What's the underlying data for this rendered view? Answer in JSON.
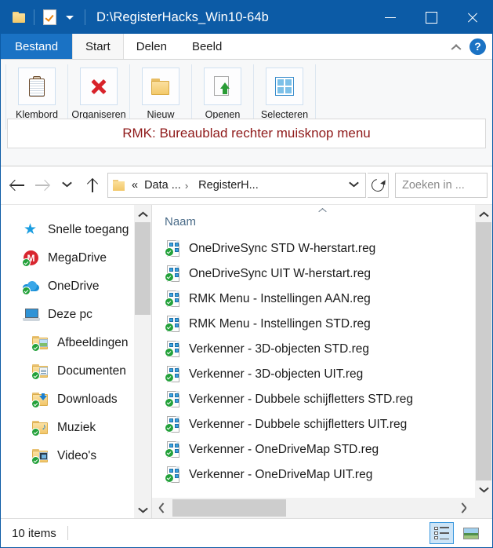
{
  "window": {
    "title": "D:\\RegisterHacks_Win10-64b",
    "quick_access": {
      "folder_icon": "folder-icon",
      "properties_icon": "properties-checkmark-icon",
      "customize_icon": "chevron-down-icon"
    },
    "controls": {
      "minimize": "minimize-icon",
      "maximize": "maximize-icon",
      "close": "close-icon"
    }
  },
  "tabs": [
    {
      "label": "Bestand",
      "state": "file-menu"
    },
    {
      "label": "Start",
      "state": "active"
    },
    {
      "label": "Delen",
      "state": "normal"
    },
    {
      "label": "Beeld",
      "state": "normal"
    }
  ],
  "tab_actions": {
    "collapse_label": "chevron-up-icon",
    "help_label": "?"
  },
  "ribbon": {
    "groups": [
      {
        "label": "Klembord",
        "icon": "clipboard-icon"
      },
      {
        "label": "Organiseren",
        "icon": "delete-x-icon"
      },
      {
        "label": "Nieuw",
        "icon": "new-folder-icon"
      },
      {
        "label": "Openen",
        "icon": "open-properties-icon"
      },
      {
        "label": "Selecteren",
        "icon": "select-all-icon"
      }
    ],
    "banner": {
      "text": "RMK: Bureaublad rechter muisknop menu",
      "color": "#8f1a1a"
    }
  },
  "addressbar": {
    "back": "arrow-left-icon",
    "forward": "arrow-right-icon",
    "recent": "chevron-down-icon",
    "up": "arrow-up-icon",
    "breadcrumb": {
      "overflow": "«",
      "parts": [
        "Data ...",
        "RegisterH..."
      ],
      "separator": "›"
    },
    "dropdown": "chevron-down-icon",
    "refresh": "refresh-icon",
    "search_placeholder": "Zoeken in ...",
    "search_value": ""
  },
  "navpane": {
    "items": [
      {
        "label": "Snelle toegang",
        "icon": "star-icon",
        "indent": 0,
        "badge": false
      },
      {
        "label": "MegaDrive",
        "icon": "megadrive-icon",
        "indent": 0,
        "badge": true
      },
      {
        "label": "OneDrive",
        "icon": "cloud-icon",
        "indent": 0,
        "badge": true
      },
      {
        "label": "Deze pc",
        "icon": "computer-icon",
        "indent": 0,
        "badge": false
      },
      {
        "label": "Afbeeldingen",
        "icon": "pictures-folder-icon",
        "indent": 1,
        "badge": true
      },
      {
        "label": "Documenten",
        "icon": "documents-folder-icon",
        "indent": 1,
        "badge": true
      },
      {
        "label": "Downloads",
        "icon": "downloads-folder-icon",
        "indent": 1,
        "badge": true
      },
      {
        "label": "Muziek",
        "icon": "music-folder-icon",
        "indent": 1,
        "badge": true
      },
      {
        "label": "Video's",
        "icon": "videos-folder-icon",
        "indent": 1,
        "badge": true
      }
    ]
  },
  "filepane": {
    "column_header": "Naam",
    "sort_indicator": "ascending",
    "files": [
      {
        "name": "OneDriveSync STD W-herstart.reg",
        "icon": "reg-file-icon"
      },
      {
        "name": "OneDriveSync UIT W-herstart.reg",
        "icon": "reg-file-icon"
      },
      {
        "name": "RMK Menu - Instellingen AAN.reg",
        "icon": "reg-file-icon"
      },
      {
        "name": "RMK Menu - Instellingen STD.reg",
        "icon": "reg-file-icon"
      },
      {
        "name": "Verkenner - 3D-objecten STD.reg",
        "icon": "reg-file-icon"
      },
      {
        "name": "Verkenner - 3D-objecten UIT.reg",
        "icon": "reg-file-icon"
      },
      {
        "name": "Verkenner - Dubbele schijfletters STD.reg",
        "icon": "reg-file-icon"
      },
      {
        "name": "Verkenner - Dubbele schijfletters UIT.reg",
        "icon": "reg-file-icon"
      },
      {
        "name": "Verkenner - OneDriveMap STD.reg",
        "icon": "reg-file-icon"
      },
      {
        "name": "Verkenner - OneDriveMap UIT.reg",
        "icon": "reg-file-icon"
      }
    ]
  },
  "statusbar": {
    "item_count": "10 items",
    "views": [
      {
        "name": "details-view",
        "selected": true
      },
      {
        "name": "large-icons-view",
        "selected": false
      }
    ]
  }
}
